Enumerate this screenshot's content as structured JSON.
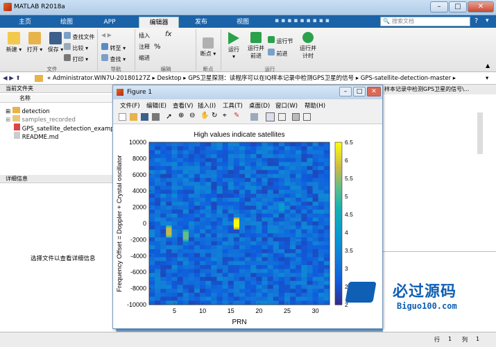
{
  "window": {
    "title": "MATLAB R2018a"
  },
  "tabs": [
    {
      "label": "主页",
      "active": false
    },
    {
      "label": "绘图",
      "active": false
    },
    {
      "label": "APP",
      "active": false
    },
    {
      "label": "编辑器",
      "active": true
    },
    {
      "label": "发布",
      "active": false
    },
    {
      "label": "视图",
      "active": false
    }
  ],
  "search": {
    "placeholder": "搜索文档"
  },
  "ribbon": {
    "file": {
      "new": "新建",
      "open": "打开",
      "save": "保存",
      "find_file": "查找文件",
      "compare": "比较",
      "print": "打印",
      "group": "文件"
    },
    "nav": {
      "goto": "转至",
      "find": "查找",
      "group": "导航"
    },
    "edit": {
      "insert": "插入",
      "comment": "注释",
      "indent": "缩进",
      "fx": "fx",
      "pct": "%",
      "group": "编辑"
    },
    "breakpoint": {
      "label": "断点",
      "group": "断点"
    },
    "run": {
      "run": "运行",
      "run_advance": "运行并\n前进",
      "run_section": "运行节",
      "advance": "前进",
      "run_time": "运行并\n计时",
      "group": "运行"
    }
  },
  "address": {
    "path": "« Administrator.WIN7U-20180127Z  ▸  Desktop  ▸  GPS卫星探测：读程序可以在IQ样本记录中检测GPS卫星的信号  ▸  GPS-satellite-detection-master  ▸"
  },
  "left_panel": {
    "header": "当前文件夹",
    "col_name": "名称",
    "files": [
      {
        "name": "detection",
        "type": "folder"
      },
      {
        "name": "samples_recorded",
        "type": "folder"
      },
      {
        "name": "GPS_satellite_detection_example.m",
        "type": "m"
      },
      {
        "name": "README.md",
        "type": "md"
      }
    ],
    "details_header": "详细信息",
    "details_hint": "选择文件以查看详细信息"
  },
  "right_panel": {
    "header": "样本记录中检测GPS卫星的信号\\..."
  },
  "figure": {
    "title": "Figure 1",
    "menu": [
      "文件(F)",
      "编辑(E)",
      "查看(V)",
      "插入(I)",
      "工具(T)",
      "桌面(D)",
      "窗口(W)",
      "帮助(H)"
    ]
  },
  "status": {
    "row_label": "行",
    "row": "1",
    "col_label": "列",
    "col": "1"
  },
  "watermark": {
    "title": "必过源码",
    "url": "Biguo100.com"
  },
  "colors": {
    "tab_blue": "#1b63a8",
    "accent": "#0f5fb4"
  },
  "chart_data": {
    "type": "heatmap",
    "title": "High values indicate satellites",
    "xlabel": "PRN",
    "ylabel": "Frequency Offset = Doppler + Crystal oscillator",
    "x_ticks": [
      5,
      10,
      15,
      20,
      25,
      30
    ],
    "y_ticks": [
      10000,
      8000,
      6000,
      4000,
      2000,
      0,
      -2000,
      -4000,
      -6000,
      -8000,
      -10000
    ],
    "xlim": [
      1,
      32
    ],
    "ylim": [
      -10000,
      10000
    ],
    "colorbar_ticks": [
      6.5,
      6,
      5.5,
      5,
      4.5,
      4,
      3.5,
      3,
      2.5,
      2
    ],
    "clim": [
      2,
      6.5
    ],
    "colormap": "parula",
    "peaks": [
      {
        "prn": 4,
        "freq": -1000,
        "value": 5.8
      },
      {
        "prn": 7,
        "freq": -1500,
        "value": 5.3
      },
      {
        "prn": 16,
        "freq": 0,
        "value": 6.5
      },
      {
        "prn": 24,
        "freq": 2000,
        "value": 4.0
      },
      {
        "prn": 27,
        "freq": -1200,
        "value": 3.5
      }
    ]
  }
}
